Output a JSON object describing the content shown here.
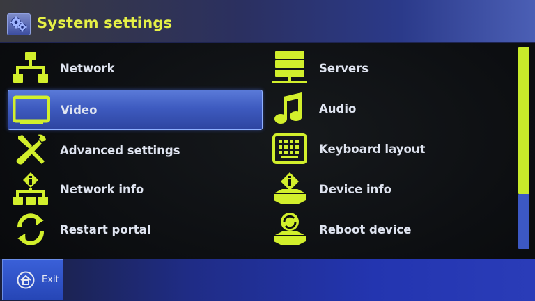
{
  "header": {
    "title": "System settings",
    "icon": "gears-icon"
  },
  "menu": {
    "left": [
      {
        "label": "Network",
        "icon": "network-icon"
      },
      {
        "label": "Video",
        "icon": "monitor-icon"
      },
      {
        "label": "Advanced settings",
        "icon": "tools-icon"
      },
      {
        "label": "Network info",
        "icon": "network-info-icon"
      },
      {
        "label": "Restart portal",
        "icon": "restart-icon"
      }
    ],
    "right": [
      {
        "label": "Servers",
        "icon": "servers-icon"
      },
      {
        "label": "Audio",
        "icon": "music-note-icon"
      },
      {
        "label": "Keyboard layout",
        "icon": "keyboard-icon"
      },
      {
        "label": "Device info",
        "icon": "device-info-icon"
      },
      {
        "label": "Reboot device",
        "icon": "reboot-icon"
      }
    ],
    "selected": "Video"
  },
  "footer": {
    "exit_label": "Exit",
    "exit_icon": "home-icon"
  },
  "colors": {
    "accent": "#e5f046",
    "icon": "#d2ef2c",
    "selection": "#3e5bc0",
    "scroll_thumb": "#c8ea2a"
  }
}
